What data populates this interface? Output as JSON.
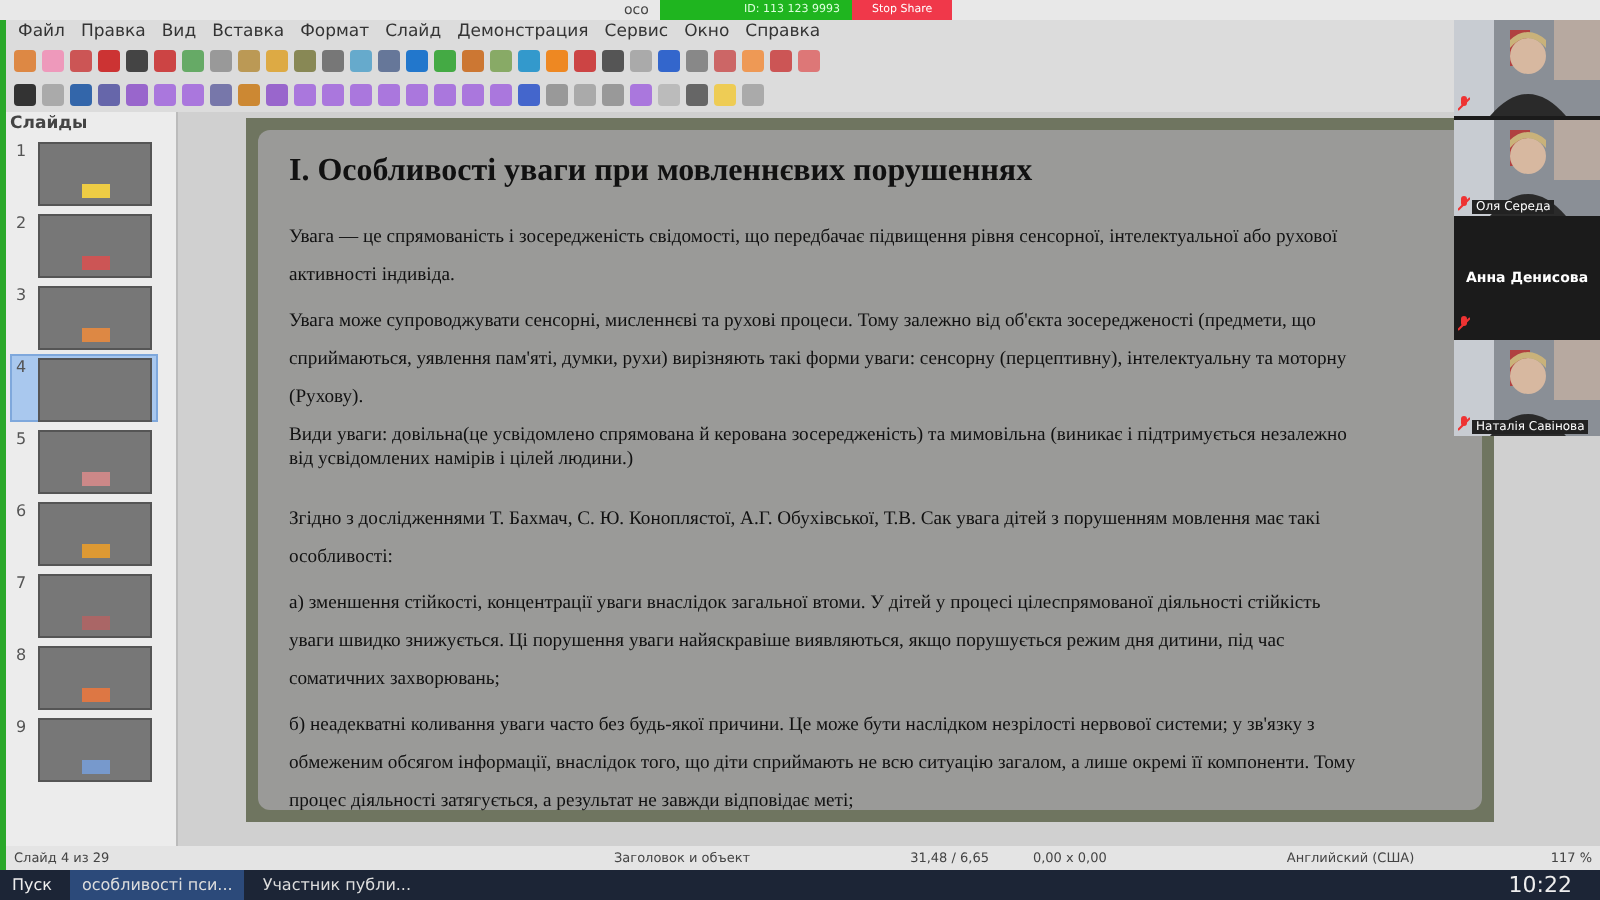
{
  "window": {
    "title": "осо"
  },
  "share_bar": {
    "meeting_id": "ID: 113 123 9993",
    "stop_button": "Stop Share"
  },
  "menu": [
    "Файл",
    "Правка",
    "Вид",
    "Вставка",
    "Формат",
    "Слайд",
    "Демонстрация",
    "Сервис",
    "Окно",
    "Справка"
  ],
  "sidebar": {
    "title": "Слайды",
    "slides": [
      {
        "number": "1",
        "selected": false
      },
      {
        "number": "2",
        "selected": false
      },
      {
        "number": "3",
        "selected": false
      },
      {
        "number": "4",
        "selected": true
      },
      {
        "number": "5",
        "selected": false
      },
      {
        "number": "6",
        "selected": false
      },
      {
        "number": "7",
        "selected": false
      },
      {
        "number": "8",
        "selected": false
      },
      {
        "number": "9",
        "selected": false
      }
    ]
  },
  "slide": {
    "title": "І. Особливості уваги при мовленнєвих порушеннях",
    "paragraphs": [
      {
        "kind": "spaced",
        "text": "Увага — це спрямованість і зосередженість свідомості, що передбачає підвищення рівня сенсорної, інтелектуальної або рухової активності індивіда."
      },
      {
        "kind": "spaced",
        "text": "Увага може супроводжувати сенсорні, мисленнєві та рухові процеси. Тому залежно від об'єкта зосередженості (предмети, що сприймаються, уявлення пам'яті, думки, рухи) вирізняють такі форми уваги: сенсорну (перцептивну), інтелектуальну та моторну (Рухову)."
      },
      {
        "kind": "tight",
        "text": "Види уваги: довільна(це усвідомлено спрямована й керована зосередженість) та мимовільна (виникає і підтримується незалежно від усвідомлених намірів і цілей людини.)"
      },
      {
        "kind": "spaced",
        "text": "Згідно з дослідженнями Т. Бахмач, С. Ю. Коноплястої, А.Г. Обухівської, Т.В. Сак увага дітей з порушенням мовлення має такі особливості:"
      },
      {
        "kind": "spaced",
        "text": "а) зменшення стійкості, концентрації уваги внаслідок загальної втоми. У дітей у процесі цілеспрямованої діяльності стійкість уваги швидко знижується. Ці порушення уваги найяскравіше виявляються, якщо порушується режим дня дитини, під час соматичних захворювань;"
      },
      {
        "kind": "spaced",
        "text": "б) неадекватні коливання уваги часто без будь-якої причини. Це може бути наслідком незрілості нервової системи; у зв'язку з обмеженим обсягом інформації, внаслідок того, що діти сприймають не всю ситуацію загалом, а лише окремі її компоненти. Тому процес діяльності затягується, а результат не завжди відповідає меті;"
      }
    ]
  },
  "participants": [
    {
      "kind": "video"
    },
    {
      "kind": "video",
      "name": "Оля Середа"
    },
    {
      "kind": "avatar",
      "name": "Анна Денисова"
    },
    {
      "kind": "video",
      "name": "Наталія Савінова"
    }
  ],
  "status_bar": {
    "slide": "Слайд 4 из 29",
    "layout": "Заголовок и объект",
    "position": "31,48 / 6,65",
    "size": "0,00 x 0,00",
    "language": "Английский (США)",
    "zoom": "117 %"
  },
  "taskbar": {
    "start": "Пуск",
    "tasks": [
      {
        "label": "особливості пси...",
        "selected": true
      },
      {
        "label": "Участник публи...",
        "selected": false
      }
    ],
    "clock": "10:22"
  }
}
